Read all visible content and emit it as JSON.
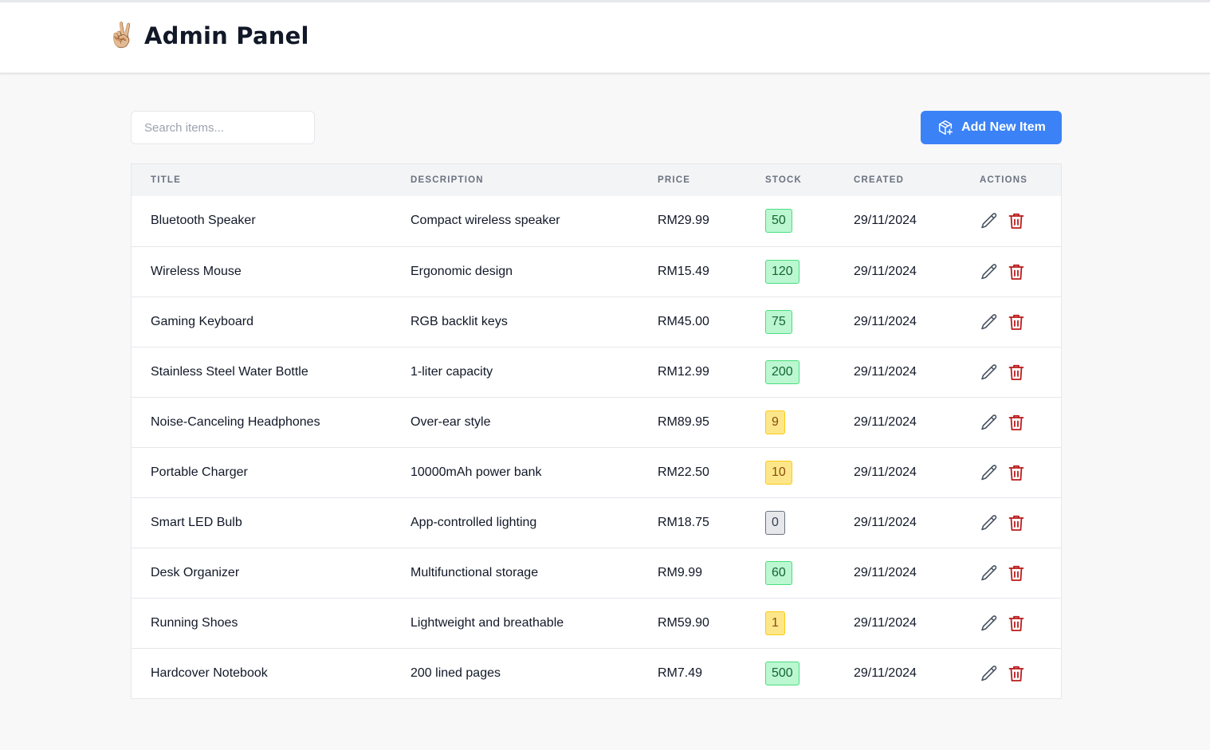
{
  "header": {
    "emoji": "✌🏼",
    "title": "Admin Panel"
  },
  "toolbar": {
    "search_placeholder": "Search items...",
    "search_value": "",
    "add_label": "Add New Item"
  },
  "table": {
    "columns": [
      "Title",
      "Description",
      "Price",
      "Stock",
      "Created",
      "Actions"
    ],
    "rows": [
      {
        "title": "Bluetooth Speaker",
        "description": "Compact wireless speaker",
        "price": "RM29.99",
        "stock": "50",
        "stock_status": "green",
        "created": "29/11/2024"
      },
      {
        "title": "Wireless Mouse",
        "description": "Ergonomic design",
        "price": "RM15.49",
        "stock": "120",
        "stock_status": "green",
        "created": "29/11/2024"
      },
      {
        "title": "Gaming Keyboard",
        "description": "RGB backlit keys",
        "price": "RM45.00",
        "stock": "75",
        "stock_status": "green",
        "created": "29/11/2024"
      },
      {
        "title": "Stainless Steel Water Bottle",
        "description": "1-liter capacity",
        "price": "RM12.99",
        "stock": "200",
        "stock_status": "green",
        "created": "29/11/2024"
      },
      {
        "title": "Noise-Canceling Headphones",
        "description": "Over-ear style",
        "price": "RM89.95",
        "stock": "9",
        "stock_status": "yellow",
        "created": "29/11/2024"
      },
      {
        "title": "Portable Charger",
        "description": "10000mAh power bank",
        "price": "RM22.50",
        "stock": "10",
        "stock_status": "yellow",
        "created": "29/11/2024"
      },
      {
        "title": "Smart LED Bulb",
        "description": "App-controlled lighting",
        "price": "RM18.75",
        "stock": "0",
        "stock_status": "gray",
        "created": "29/11/2024"
      },
      {
        "title": "Desk Organizer",
        "description": "Multifunctional storage",
        "price": "RM9.99",
        "stock": "60",
        "stock_status": "green",
        "created": "29/11/2024"
      },
      {
        "title": "Running Shoes",
        "description": "Lightweight and breathable",
        "price": "RM59.90",
        "stock": "1",
        "stock_status": "yellow",
        "created": "29/11/2024"
      },
      {
        "title": "Hardcover Notebook",
        "description": "200 lined pages",
        "price": "RM7.49",
        "stock": "500",
        "stock_status": "green",
        "created": "29/11/2024"
      }
    ]
  },
  "icons": {
    "add": "package-plus-icon",
    "edit": "pencil-icon",
    "delete": "trash-icon"
  },
  "colors": {
    "primary": "#3b82f6",
    "delete": "#b91c1c",
    "edit": "#4b5563",
    "stock_green": "#bbf7d0",
    "stock_yellow": "#fde68a",
    "stock_gray": "#e5e7eb"
  }
}
